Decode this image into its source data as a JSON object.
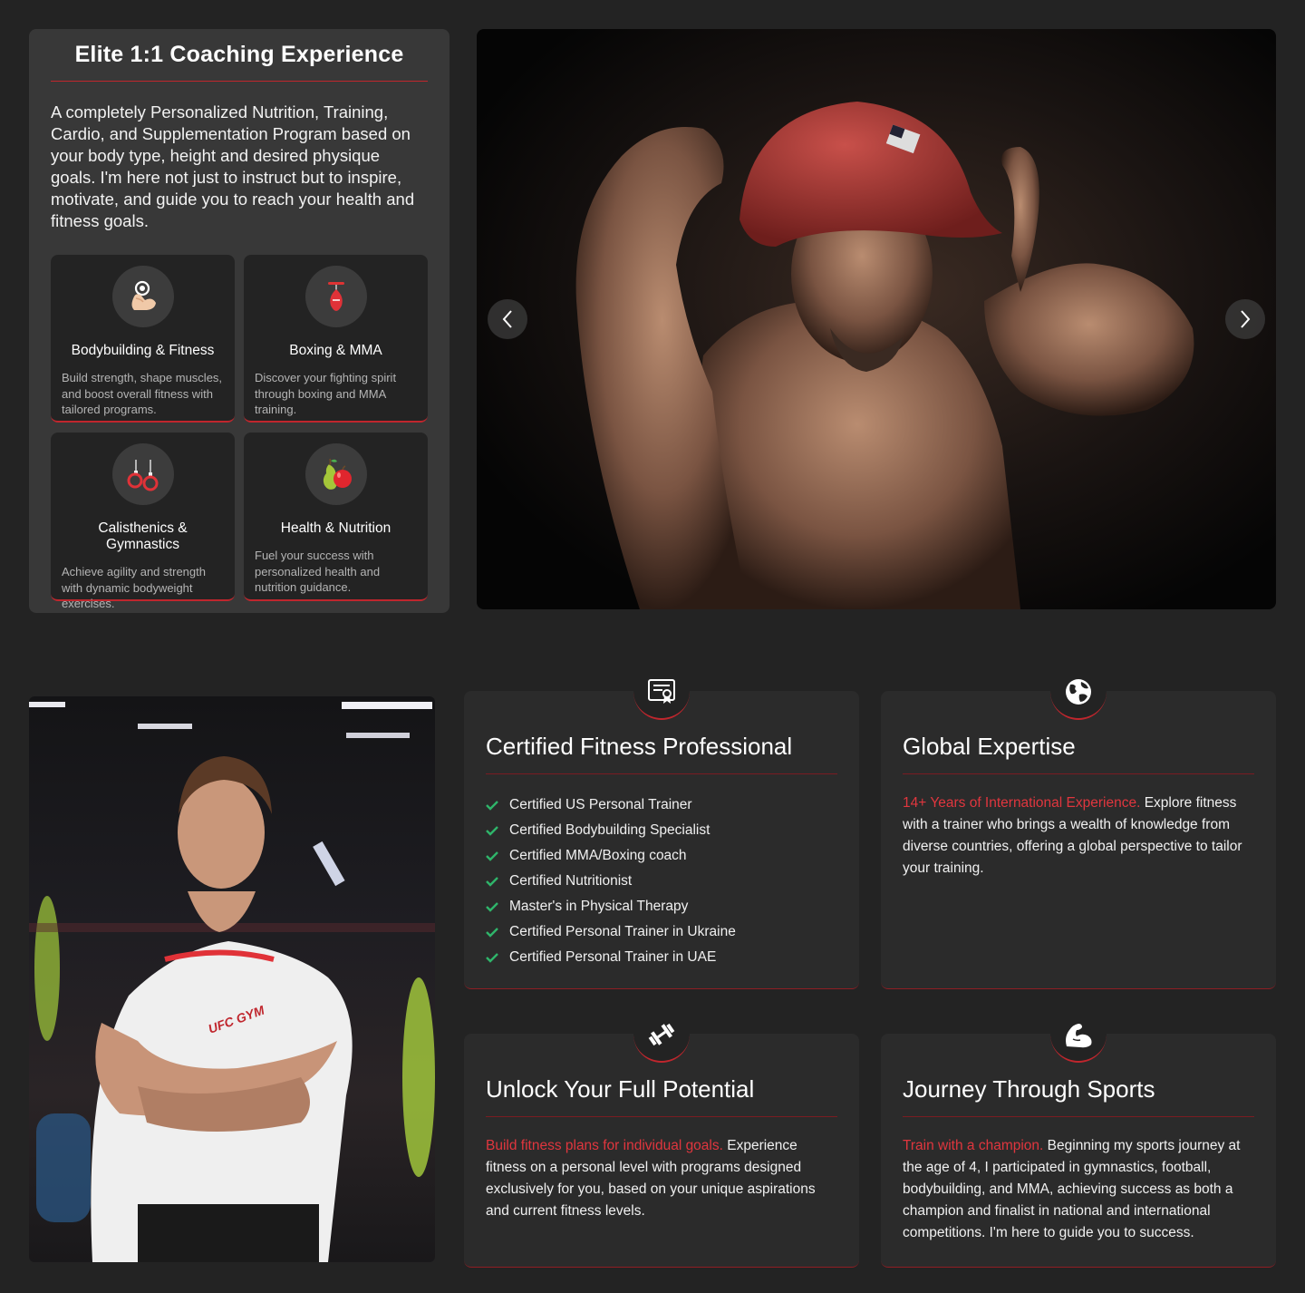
{
  "coaching": {
    "title": "Elite 1:1 Coaching Experience",
    "description": "A completely Personalized Nutrition, Training, Cardio, and Supplementation Program based on your body type, height and desired physique goals. I'm here not just to instruct but to inspire, motivate, and guide you to reach your health and fitness goals.",
    "cards": [
      {
        "title": "Bodybuilding & Fitness",
        "text": "Build strength, shape muscles, and boost overall fitness with tailored programs.",
        "icon": "flexed-arm-dumbbell-icon"
      },
      {
        "title": "Boxing & MMA",
        "text": "Discover your fighting spirit through boxing and MMA training.",
        "icon": "punching-bag-icon"
      },
      {
        "title": "Calisthenics & Gymnastics",
        "text": "Achieve agility and strength with dynamic bodyweight exercises.",
        "icon": "gymnastic-rings-icon"
      },
      {
        "title": "Health & Nutrition",
        "text": "Fuel your success with personalized health and nutrition guidance.",
        "icon": "fruits-icon"
      }
    ]
  },
  "carousel": {
    "prev_icon": "chevron-left-icon",
    "next_icon": "chevron-right-icon"
  },
  "features": {
    "certified": {
      "title": "Certified Fitness Professional",
      "icon": "certificate-icon",
      "items": [
        "Certified US Personal Trainer",
        "Certified Bodybuilding Specialist",
        "Certified MMA/Boxing coach",
        "Certified Nutritionist",
        "Master's in Physical Therapy",
        "Certified Personal Trainer in Ukraine",
        "Certified Personal Trainer in UAE"
      ]
    },
    "global": {
      "title": "Global Expertise",
      "icon": "globe-icon",
      "highlight": "14+ Years of International Experience.",
      "text": " Explore fitness with a trainer who brings a wealth of knowledge from diverse countries, offering a global perspective to tailor your training."
    },
    "potential": {
      "title": "Unlock Your Full Potential",
      "icon": "dumbbell-icon",
      "highlight": "Build fitness plans for individual goals.",
      "text": " Experience fitness on a personal level with programs designed exclusively for you, based on your unique aspirations and current fitness levels."
    },
    "sports": {
      "title": "Journey Through Sports",
      "icon": "flexed-arm-icon",
      "highlight": "Train with a champion.",
      "text": " Beginning my sports journey at the age of 4, I participated in gymnastics, football, bodybuilding, and MMA, achieving success as both a champion and finalist in national and international competitions. I'm here to guide you to success."
    }
  },
  "colors": {
    "accent": "#c0262d",
    "accent_text": "#e0363e",
    "check": "#2fb56a",
    "background": "#232323"
  }
}
